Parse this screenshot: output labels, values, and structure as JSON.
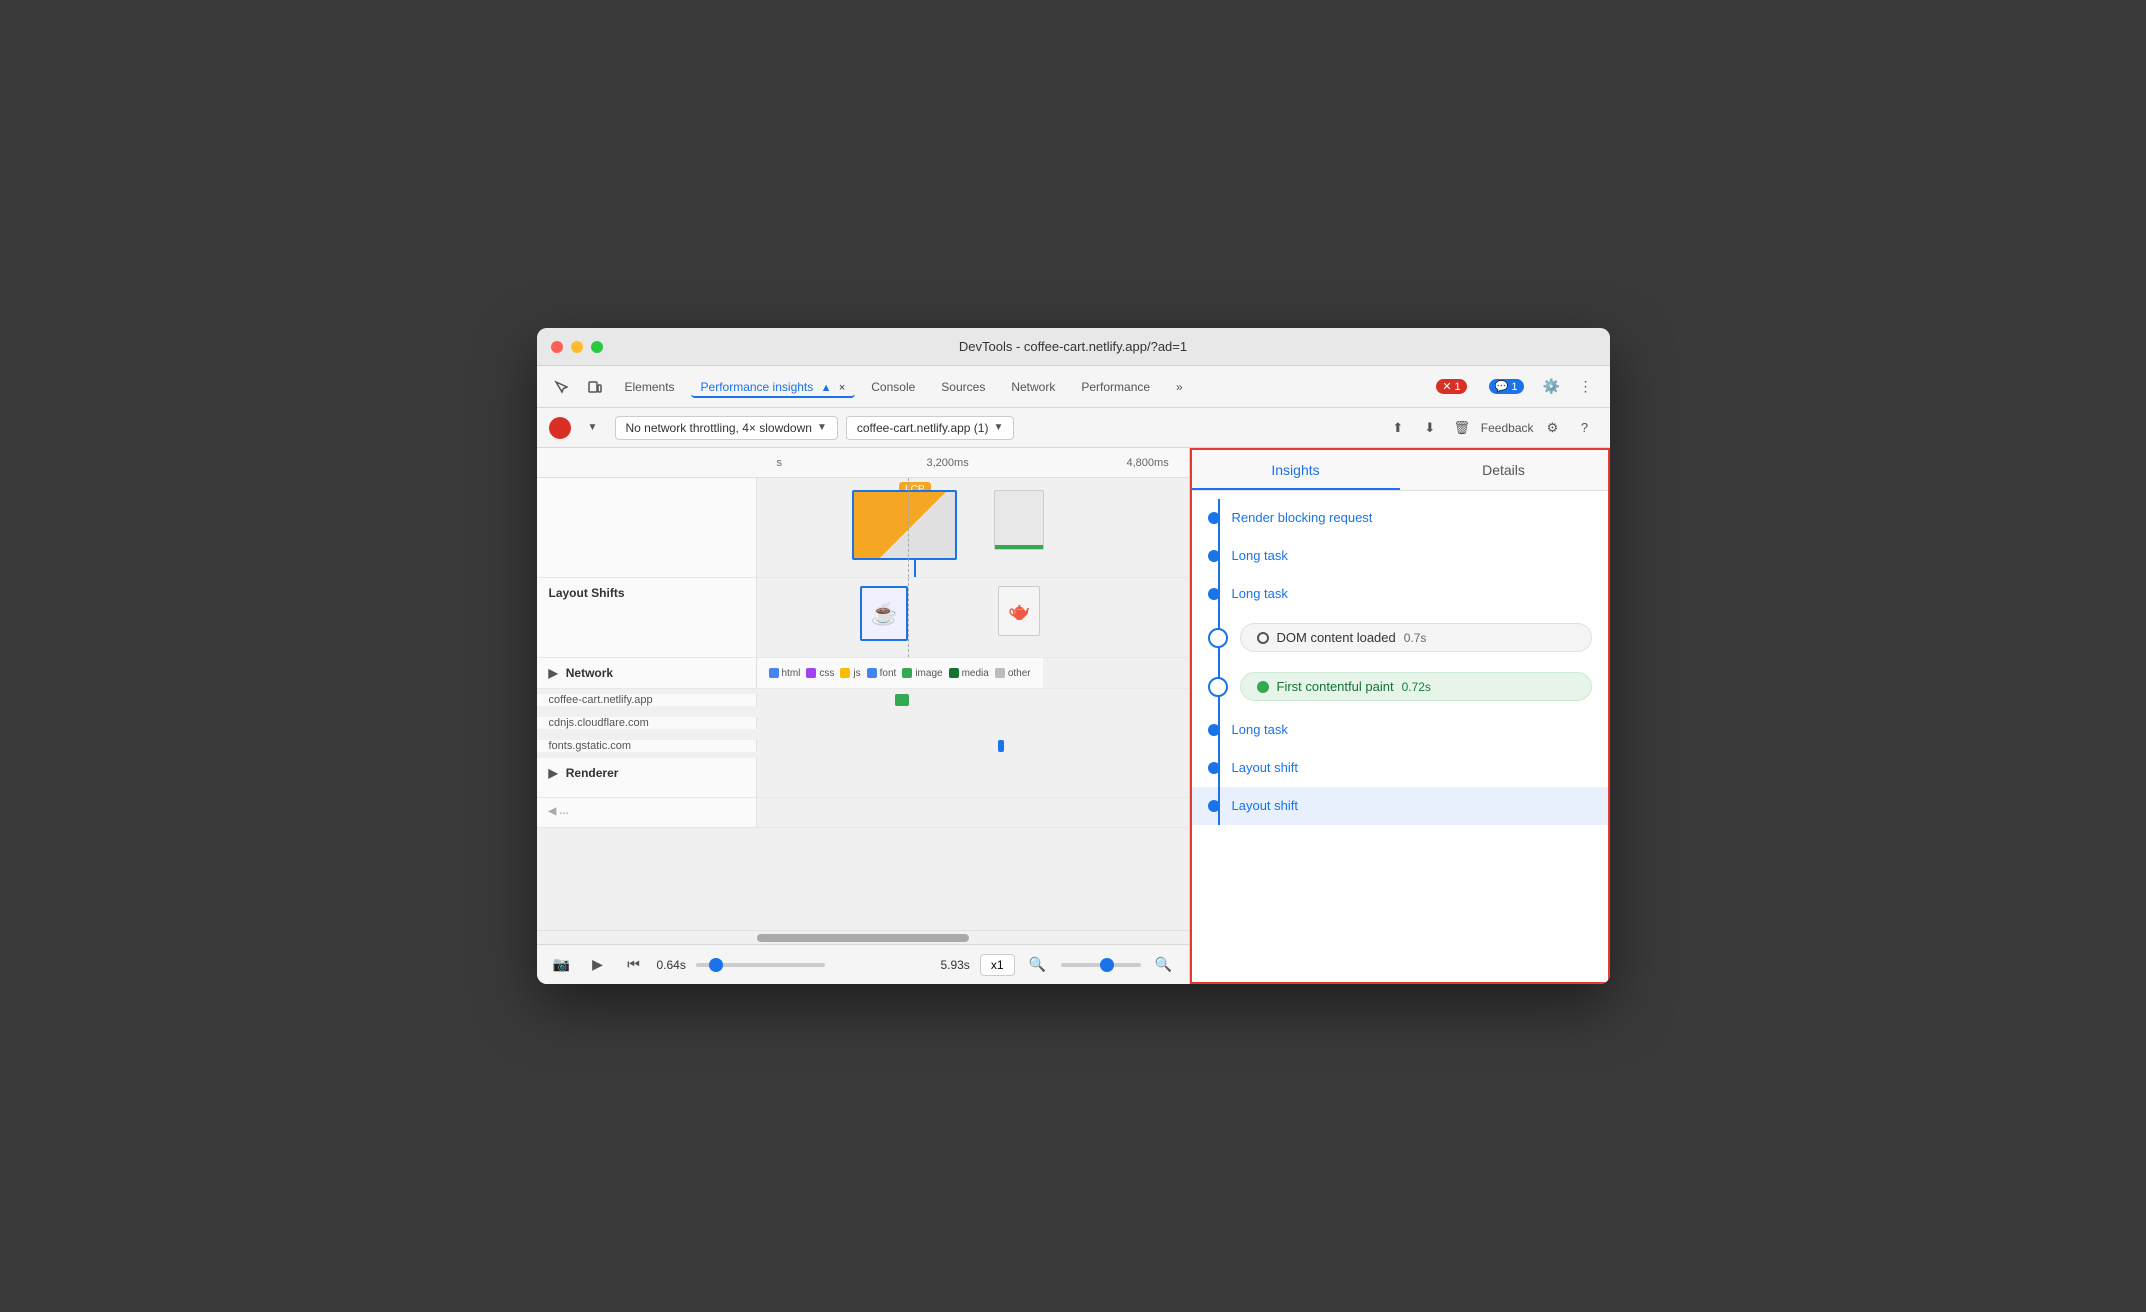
{
  "window": {
    "title": "DevTools - coffee-cart.netlify.app/?ad=1"
  },
  "tabs": {
    "elements": "Elements",
    "performance_insights": "Performance insights",
    "console": "Console",
    "sources": "Sources",
    "network": "Network",
    "performance": "Performance",
    "more": "»"
  },
  "toolbar2": {
    "network_throttle": "No network throttling, 4× slowdown",
    "site": "coffee-cart.netlify.app (1)",
    "feedback": "Feedback"
  },
  "timeline": {
    "time_labels": [
      "s",
      "3,200ms",
      "4,800ms"
    ],
    "lcp_label": "LCP",
    "sections": {
      "layout_shifts": "Layout Shifts",
      "network": "Network",
      "renderer": "Renderer"
    },
    "legend": {
      "html": "html",
      "css": "css",
      "js": "js",
      "font": "font",
      "image": "image",
      "media": "media",
      "other": "other"
    },
    "network_rows": [
      "coffee-cart.netlify.app",
      "cdnjs.cloudflare.com",
      "fonts.gstatic.com"
    ],
    "time_start": "0.64s",
    "time_end": "5.93s",
    "speed": "x1"
  },
  "insights": {
    "tab_insights": "Insights",
    "tab_details": "Details",
    "items": [
      {
        "type": "link",
        "text": "Render blocking request"
      },
      {
        "type": "link",
        "text": "Long task"
      },
      {
        "type": "link",
        "text": "Long task"
      },
      {
        "type": "pill",
        "text": "DOM content loaded",
        "time": "0.7s"
      },
      {
        "type": "pill-green",
        "text": "First contentful paint",
        "time": "0.72s"
      },
      {
        "type": "link",
        "text": "Long task"
      },
      {
        "type": "link",
        "text": "Layout shift"
      },
      {
        "type": "link",
        "text": "Layout shift"
      }
    ]
  },
  "legend_colors": {
    "html": "#4285f4",
    "css": "#a142f4",
    "js": "#fbbc04",
    "font": "#4285f4",
    "image": "#34a853",
    "media": "#137333",
    "other": "#bdbdbd"
  }
}
